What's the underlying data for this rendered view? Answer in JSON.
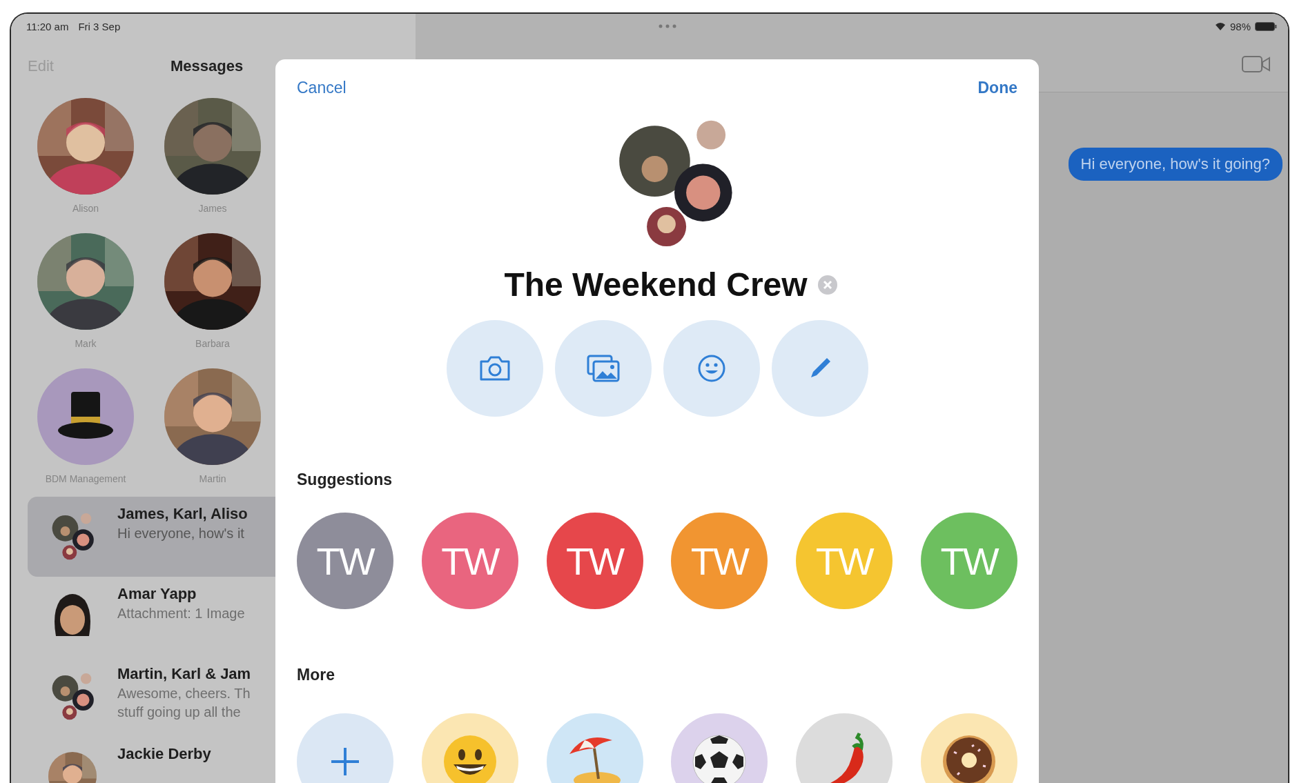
{
  "status_bar": {
    "time": "11:20 am",
    "date": "Fri 3 Sep",
    "battery": "98%"
  },
  "sidebar": {
    "edit": "Edit",
    "title": "Messages",
    "pinned": [
      {
        "name": "Alison"
      },
      {
        "name": "James"
      },
      {
        "name": "Mark"
      },
      {
        "name": "Barbara"
      },
      {
        "name": "BDM Management",
        "kind": "hat"
      },
      {
        "name": "Martin"
      }
    ],
    "conversations": [
      {
        "title": "James, Karl, Aliso",
        "preview": [
          "Hi everyone, how's it"
        ],
        "kind": "group",
        "selected": true
      },
      {
        "title": "Amar Yapp",
        "preview": [
          "Attachment: 1 Image"
        ],
        "kind": "memoji",
        "selected": false
      },
      {
        "title": "Martin, Karl & Jam",
        "preview": [
          "Awesome, cheers. Th",
          "stuff going up all the"
        ],
        "kind": "group",
        "selected": false
      },
      {
        "title": "Jackie Derby",
        "selected": false
      }
    ]
  },
  "conversation": {
    "messages": [
      {
        "text": "Hi everyone, how's it going?"
      }
    ]
  },
  "modal": {
    "cancel": "Cancel",
    "done": "Done",
    "group_name": "The Weekend Crew",
    "actions": [
      {
        "kind": "camera"
      },
      {
        "kind": "photos"
      },
      {
        "kind": "emoji"
      },
      {
        "kind": "pencil"
      }
    ],
    "suggestions_heading": "Suggestions",
    "suggestions": [
      {
        "label": "TW",
        "color": "#8e8d9a"
      },
      {
        "label": "TW",
        "color": "#e9657f"
      },
      {
        "label": "TW",
        "color": "#e6474b"
      },
      {
        "label": "TW",
        "color": "#f19531"
      },
      {
        "label": "TW",
        "color": "#f5c530"
      },
      {
        "label": "TW",
        "color": "#6dbf5f"
      }
    ],
    "more_heading": "More",
    "more": [
      {
        "kind": "add"
      },
      {
        "kind": "smiley"
      },
      {
        "kind": "beach"
      },
      {
        "kind": "soccer"
      },
      {
        "kind": "chili"
      },
      {
        "kind": "donut"
      }
    ]
  }
}
